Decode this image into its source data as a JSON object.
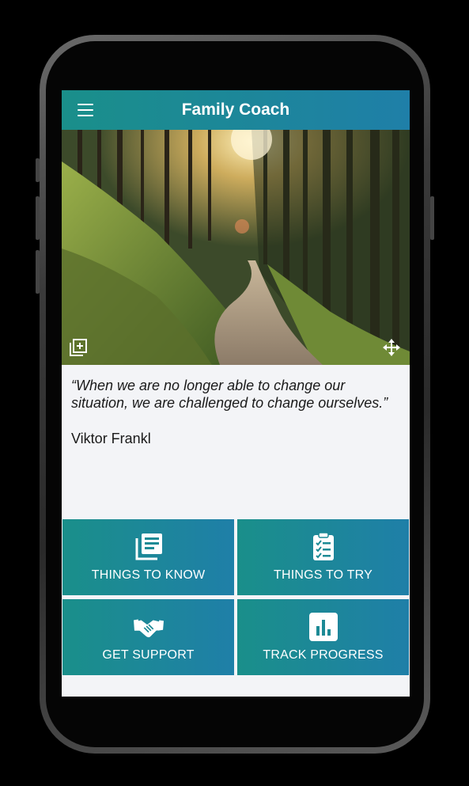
{
  "app": {
    "title": "Family Coach"
  },
  "header": {
    "menu_icon": "hamburger-menu-icon"
  },
  "hero": {
    "add_icon": "add-to-collection-icon",
    "expand_icon": "expand-arrows-icon"
  },
  "quote": {
    "text": "“When we are no longer able to change our situation, we are challenged to change ourselves.”",
    "author": "Viktor Frankl"
  },
  "tiles": [
    {
      "label": "THINGS TO KNOW",
      "icon": "articles-icon"
    },
    {
      "label": "THINGS TO TRY",
      "icon": "checklist-icon"
    },
    {
      "label": "GET SUPPORT",
      "icon": "handshake-icon"
    },
    {
      "label": "TRACK PROGRESS",
      "icon": "bar-chart-icon"
    }
  ],
  "colors": {
    "accent_start": "#1a8f8a",
    "accent_end": "#1f7fa8",
    "background": "#f3f4f7"
  }
}
